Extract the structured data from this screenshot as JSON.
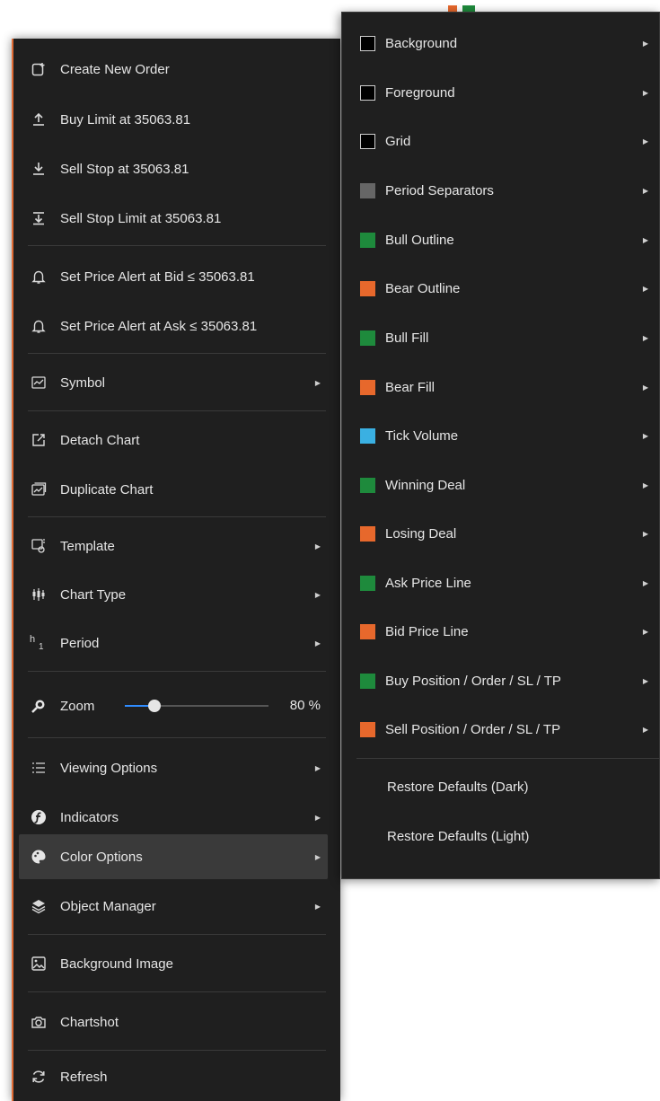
{
  "menu": {
    "items": [
      {
        "label": "Create New Order",
        "icon": "new-order-icon"
      },
      {
        "label": "Buy Limit at 35063.81",
        "icon": "buy-limit-icon"
      },
      {
        "label": "Sell Stop at 35063.81",
        "icon": "sell-stop-icon"
      },
      {
        "label": "Sell Stop Limit at 35063.81",
        "icon": "sell-stop-limit-icon"
      },
      {
        "label": "Set Price Alert at Bid ≤ 35063.81",
        "icon": "bell-icon"
      },
      {
        "label": "Set Price Alert at Ask ≤ 35063.81",
        "icon": "bell-icon"
      },
      {
        "label": "Symbol",
        "icon": "symbol-icon"
      },
      {
        "label": "Detach Chart",
        "icon": "detach-icon"
      },
      {
        "label": "Duplicate Chart",
        "icon": "duplicate-chart-icon"
      },
      {
        "label": "Template",
        "icon": "template-icon"
      },
      {
        "label": "Chart Type",
        "icon": "candlestick-icon"
      },
      {
        "label": "Period",
        "icon": "period-icon"
      },
      {
        "label": "Zoom",
        "icon": "zoom-icon"
      },
      {
        "label": "Viewing Options",
        "icon": "list-icon"
      },
      {
        "label": "Indicators",
        "icon": "indicators-icon"
      },
      {
        "label": "Color Options",
        "icon": "palette-icon"
      },
      {
        "label": "Object Manager",
        "icon": "layers-icon"
      },
      {
        "label": "Background Image",
        "icon": "image-icon"
      },
      {
        "label": "Chartshot",
        "icon": "camera-icon"
      },
      {
        "label": "Refresh",
        "icon": "refresh-icon"
      }
    ],
    "zoom": {
      "value": 80,
      "value_label": "80 %"
    },
    "active_item": "Color Options"
  },
  "color_submenu": {
    "items": [
      {
        "label": "Background",
        "color": "#000000"
      },
      {
        "label": "Foreground",
        "color": "#000000"
      },
      {
        "label": "Grid",
        "color": "#000000"
      },
      {
        "label": "Period Separators",
        "color": "#666666"
      },
      {
        "label": "Bull Outline",
        "color": "#1e8a3c"
      },
      {
        "label": "Bear Outline",
        "color": "#e7682c"
      },
      {
        "label": "Bull Fill",
        "color": "#1e8a3c"
      },
      {
        "label": "Bear Fill",
        "color": "#e7682c"
      },
      {
        "label": "Tick Volume",
        "color": "#3ab0e2"
      },
      {
        "label": "Winning Deal",
        "color": "#1e8a3c"
      },
      {
        "label": "Losing Deal",
        "color": "#e7682c"
      },
      {
        "label": "Ask Price Line",
        "color": "#1e8a3c"
      },
      {
        "label": "Bid Price Line",
        "color": "#e7682c"
      },
      {
        "label": "Buy Position / Order / SL / TP",
        "color": "#1e8a3c"
      },
      {
        "label": "Sell Position / Order / SL / TP",
        "color": "#e7682c"
      }
    ],
    "restore_dark": "Restore Defaults (Dark)",
    "restore_light": "Restore Defaults (Light)"
  }
}
